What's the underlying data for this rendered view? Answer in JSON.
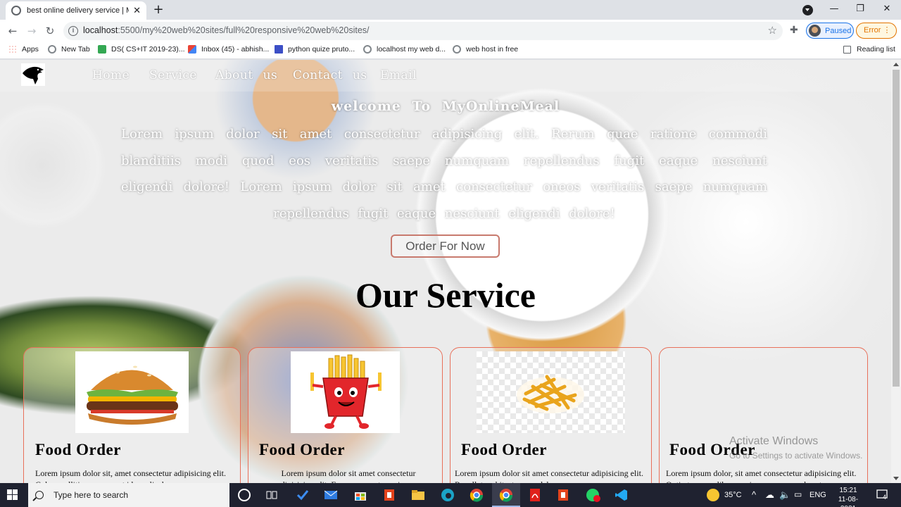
{
  "browser": {
    "tab_title": "best online delivery service | MyO",
    "url_host": "localhost",
    "url_rest": ":5500/my%20web%20sites/full%20responsive%20web%20sites/",
    "profile_label": "Paused",
    "error_label": "Error",
    "bookmarks": [
      "Apps",
      "New Tab",
      "DS( CS+IT 2019-23)...",
      "Inbox (45) - abhish...",
      "python quize pruto...",
      "localhost my web d...",
      "web host in free"
    ],
    "reading_list": "Reading list"
  },
  "site": {
    "nav": [
      "Home",
      "Service",
      "About us",
      "Contact us",
      "Email"
    ],
    "welcome": "welcome To MyOnlineMeal",
    "intro": "Lorem ipsum dolor sit amet consectetur adipisicing elit. Rerum quae ratione commodi blanditiis modi quod eos veritatis saepe numquam repellendus fugit eaque nesciunt eligendi dolore! Lorem ipsum dolor sit amet consectetur oneos veritatis saepe numquam repellendus fugit eaque nesciunt eligendi dolore!",
    "order_button": "Order For Now",
    "services_title": "Our Service",
    "cards": [
      {
        "title": "Food Order",
        "text": "Lorem ipsum dolor sit, amet consectetur adipisicing elit. Culpa mollitia neque amet id, explicabo a"
      },
      {
        "title": "Food Order",
        "text": "Lorem ipsum dolor sit amet consectetur adipisicing elit. Facere quaerat omnis cum"
      },
      {
        "title": "Food Order",
        "text": "Lorem ipsum dolor sit amet consectetur adipisicing elit. Repellat architecto, quos laborum quam com"
      },
      {
        "title": "Food Order",
        "text": "Lorem ipsum dolor, sit amet consectetur adipisicing elit. Optio tempora libero, quisquam recusandae et"
      }
    ]
  },
  "watermark": {
    "title": "Activate Windows",
    "subtitle": "Go to Settings to activate Windows."
  },
  "taskbar": {
    "search_placeholder": "Type here to search",
    "temperature": "35°C",
    "language": "ENG",
    "time": "15:21",
    "date": "11-08-2021",
    "notifications": "4"
  },
  "colors": {
    "card_border": "#e8705a",
    "accent_blue": "#1a73e8",
    "error_orange": "#e37400",
    "taskbar": "#1f2230"
  }
}
